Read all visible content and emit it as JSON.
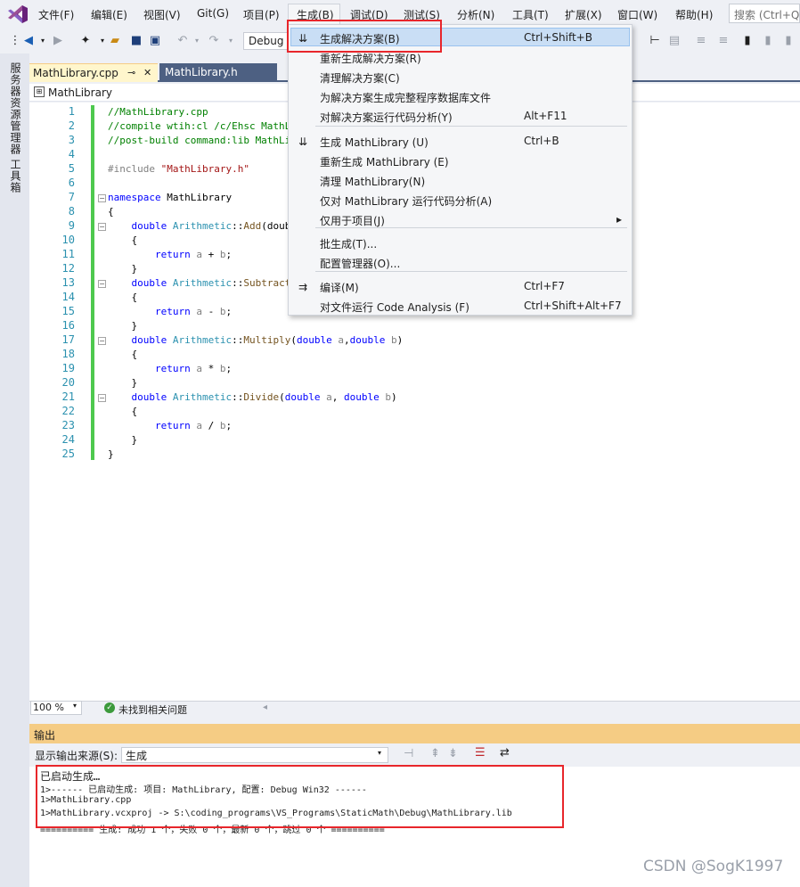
{
  "menubar": {
    "items": [
      "文件(F)",
      "编辑(E)",
      "视图(V)",
      "Git(G)",
      "项目(P)",
      "生成(B)",
      "调试(D)",
      "测试(S)",
      "分析(N)",
      "工具(T)",
      "扩展(X)",
      "窗口(W)",
      "帮助(H)"
    ],
    "search_placeholder": "搜索 (Ctrl+Q)"
  },
  "toolbar": {
    "configuration": "Debug"
  },
  "side_strip": {
    "items": [
      "服务器资源管理器",
      "工具箱"
    ]
  },
  "tabs": [
    {
      "label": "MathLibrary.cpp",
      "pin": "⊸",
      "close": "✕"
    },
    {
      "label": "MathLibrary.h"
    }
  ],
  "navbar": {
    "scope": "MathLibrary"
  },
  "editor": {
    "line_numbers": [
      "1",
      "2",
      "3",
      "4",
      "5",
      "6",
      "7",
      "8",
      "9",
      "10",
      "11",
      "12",
      "13",
      "14",
      "15",
      "16",
      "17",
      "18",
      "19",
      "20",
      "21",
      "22",
      "23",
      "24",
      "25"
    ],
    "lines": [
      "//MathLibrary.cpp",
      "//compile wtih:cl /c/Ehsc MathLi",
      "//post-build command:lib MathLib",
      "",
      "#include \"MathLibrary.h\"",
      "",
      "namespace MathLibrary",
      "{",
      "    double Arithmetic::Add(doubl",
      "    {",
      "        return a + b;",
      "    }",
      "    double Arithmetic::Subtract(",
      "    {",
      "        return a - b;",
      "    }",
      "    double Arithmetic::Multiply(double a,double b)",
      "    {",
      "        return a * b;",
      "    }",
      "    double Arithmetic::Divide(double a, double b)",
      "    {",
      "        return a / b;",
      "    }",
      "}"
    ]
  },
  "status": {
    "zoom": "100 %",
    "issues": "未找到相关问题"
  },
  "output": {
    "title": "输出",
    "source_label": "显示输出来源(S):",
    "source_value": "生成",
    "lines": [
      "已启动生成…",
      "1>------ 已启动生成: 项目: MathLibrary, 配置: Debug Win32 ------",
      "1>MathLibrary.cpp",
      "1>MathLibrary.vcxproj -> S:\\coding_programs\\VS_Programs\\StaticMath\\Debug\\MathLibrary.lib",
      "========== 生成: 成功 1 个，失败 0 个，最新 0 个，跳过 0 个 =========="
    ]
  },
  "build_menu": {
    "groups": [
      [
        {
          "label": "生成解决方案(B)",
          "shortcut": "Ctrl+Shift+B",
          "icon": "build-solution-icon",
          "highlighted": true
        },
        {
          "label": "重新生成解决方案(R)",
          "shortcut": ""
        },
        {
          "label": "清理解决方案(C)",
          "shortcut": ""
        },
        {
          "label": "为解决方案生成完整程序数据库文件",
          "shortcut": ""
        },
        {
          "label": "对解决方案运行代码分析(Y)",
          "shortcut": "Alt+F11"
        }
      ],
      [
        {
          "label": "生成 MathLibrary (U)",
          "shortcut": "Ctrl+B",
          "icon": "build-project-icon"
        },
        {
          "label": "重新生成 MathLibrary (E)",
          "shortcut": ""
        },
        {
          "label": "清理 MathLibrary(N)",
          "shortcut": ""
        },
        {
          "label": "仅对 MathLibrary 运行代码分析(A)",
          "shortcut": ""
        },
        {
          "label": "仅用于项目(J)",
          "shortcut": "",
          "submenu": "▸"
        }
      ],
      [
        {
          "label": "批生成(T)...",
          "shortcut": ""
        },
        {
          "label": "配置管理器(O)...",
          "shortcut": ""
        }
      ],
      [
        {
          "label": "编译(M)",
          "shortcut": "Ctrl+F7",
          "icon": "compile-icon"
        },
        {
          "label": "对文件运行 Code Analysis (F)",
          "shortcut": "Ctrl+Shift+Alt+F7"
        }
      ]
    ]
  },
  "watermark": "CSDN @SogK1997",
  "colors": {
    "accent": "#68217a",
    "highlight": "#c9def5",
    "output_header": "#f5cc84",
    "annotation": "#e8262b",
    "tab_active": "#fff6cc",
    "tab_inactive": "#4d6082"
  }
}
